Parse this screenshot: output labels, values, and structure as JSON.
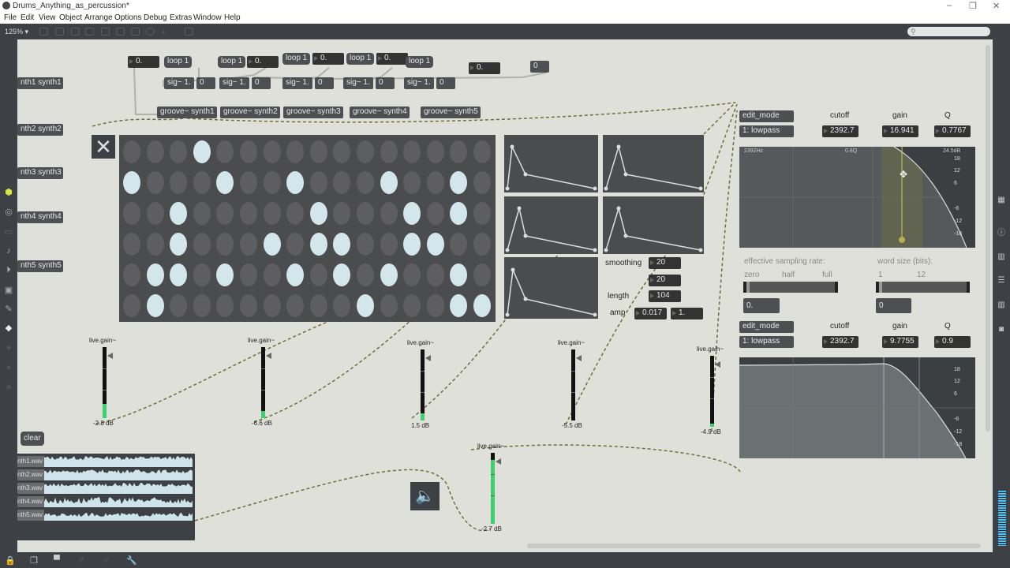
{
  "window": {
    "title": "Drums_Anything_as_percussion*",
    "controls": [
      "–",
      "❐",
      "✕"
    ]
  },
  "menu": [
    "File",
    "Edit",
    "View",
    "Object",
    "Arrange",
    "Options",
    "Debug",
    "Extras",
    "Window",
    "Help"
  ],
  "toolbar": {
    "zoom": "125% ▾",
    "search_placeholder": ""
  },
  "send_objects": [
    "nth1 synth1",
    "nth2 synth2",
    "nth3 synth3",
    "nth4 synth4",
    "nth5 synth5"
  ],
  "top_objects": {
    "numbers_float": [
      "0.",
      "0.",
      "0.",
      "0.",
      "0.",
      "0."
    ],
    "loops": [
      "loop 1",
      "loop 1",
      "loop 1",
      "loop 1",
      "loop 1"
    ],
    "sigs": [
      "sig~ 1.",
      "sig~ 1.",
      "sig~ 1.",
      "sig~ 1.",
      "sig~ 1."
    ],
    "sig_ints": [
      "0",
      "0",
      "0",
      "0",
      "0"
    ],
    "int_box": "0",
    "grooves": [
      "groove~ synth1",
      "groove~ synth2",
      "groove~ synth3",
      "groove~ synth4",
      "groove~ synth5"
    ]
  },
  "close_button": "✕",
  "sequencer": {
    "columns": 16,
    "rows": [
      [
        3
      ],
      [
        0,
        4,
        7,
        11,
        14
      ],
      [
        2,
        8,
        12,
        14
      ],
      [
        2,
        6,
        8,
        9,
        12,
        13
      ],
      [
        1,
        2,
        4,
        7,
        9,
        11,
        14
      ],
      [
        1,
        10,
        14,
        15
      ]
    ]
  },
  "envelope_controls": {
    "smoothing_label": "smoothing",
    "smoothing": "20",
    "second": "20",
    "length_label": "length",
    "length": "104",
    "amp_label": "amp",
    "amp": "0.017",
    "amp2": "1."
  },
  "gains": [
    {
      "label": "live.gain~",
      "value": "-2.8 dB",
      "level": 0.2
    },
    {
      "label": "live.gain~",
      "value": "-6.6 dB",
      "level": 0.1
    },
    {
      "label": "live.gain~",
      "value": "1.5 dB",
      "level": 0.1
    },
    {
      "label": "live.gain~",
      "value": "-5.5 dB",
      "level": 0.0
    },
    {
      "label": "live.gain~",
      "value": "-4.9 dB",
      "level": 0.05
    }
  ],
  "master_gain": {
    "label": "live.gain~",
    "value": "-2.7 dB",
    "level": 0.9
  },
  "filter1": {
    "edit_mode": "edit_mode",
    "mode": "1: lowpass",
    "cutoff_label": "cutoff",
    "cutoff": "2392.7",
    "gain_label": "gain",
    "gain": "16.941",
    "q_label": "Q",
    "q": "0.7767",
    "display_freq": "2392Hz",
    "display_q": "0.8Q",
    "display_db": "24.5dB",
    "db_scale": [
      "18",
      "12",
      "6",
      "-6",
      "-12",
      "-18"
    ]
  },
  "degrade": {
    "rate_label": "effective sampling rate:",
    "rate_ticks": [
      "zero",
      "half",
      "full"
    ],
    "rate_value": "0.",
    "bits_label": "word size (bits):",
    "bits_ticks": [
      "1",
      "12"
    ],
    "bits_value": "0"
  },
  "filter2": {
    "edit_mode": "edit_mode",
    "mode": "1: lowpass",
    "cutoff_label": "cutoff",
    "cutoff": "2392.7",
    "gain_label": "gain",
    "gain": "9.7755",
    "q_label": "Q",
    "q": "0.9",
    "db_scale": [
      "18",
      "12",
      "6",
      "-6",
      "-12",
      "-18"
    ]
  },
  "clear_button": "clear",
  "files": [
    "nth1.wav",
    "nth2.wav",
    "nth3.wav",
    "nth4.wav",
    "nth5.wav"
  ]
}
